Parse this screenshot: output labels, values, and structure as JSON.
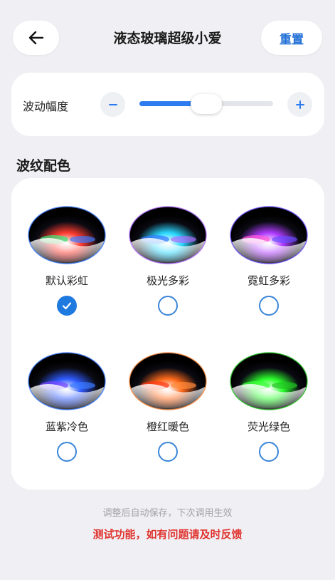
{
  "header": {
    "title": "液态玻璃超级小爱",
    "reset_label": "重置",
    "back_icon": "arrow-left-icon"
  },
  "amplitude": {
    "label": "波动幅度",
    "value_fraction": 0.5,
    "accent": "#2f7cf0"
  },
  "palette": {
    "title": "波纹配色",
    "options": [
      {
        "label": "默认彩虹",
        "checked": true,
        "colors": [
          "#ff3b30",
          "#ffffff",
          "#3ee07a",
          "#3b7bff"
        ]
      },
      {
        "label": "极光多彩",
        "checked": false,
        "colors": [
          "#2ad8ff",
          "#ffffff",
          "#3b7bff",
          "#b06bff"
        ]
      },
      {
        "label": "霓虹多彩",
        "checked": false,
        "colors": [
          "#b03bff",
          "#ffffff",
          "#ff5ad6",
          "#6a4bff"
        ]
      },
      {
        "label": "蓝紫冷色",
        "checked": false,
        "colors": [
          "#2f5bff",
          "#ffffff",
          "#7a4bff",
          "#3b7bff"
        ]
      },
      {
        "label": "橙红暖色",
        "checked": false,
        "colors": [
          "#ff6a1a",
          "#ffffff",
          "#ff3b1a",
          "#ff8a3b"
        ]
      },
      {
        "label": "荧光绿色",
        "checked": false,
        "colors": [
          "#2bff2b",
          "#ffffff",
          "#3dff3d",
          "#22c322"
        ]
      }
    ]
  },
  "footer": {
    "note": "调整后自动保存，下次调用生效",
    "warning": "测试功能，如有问题请及时反馈",
    "warning_color": "#e0342f"
  }
}
